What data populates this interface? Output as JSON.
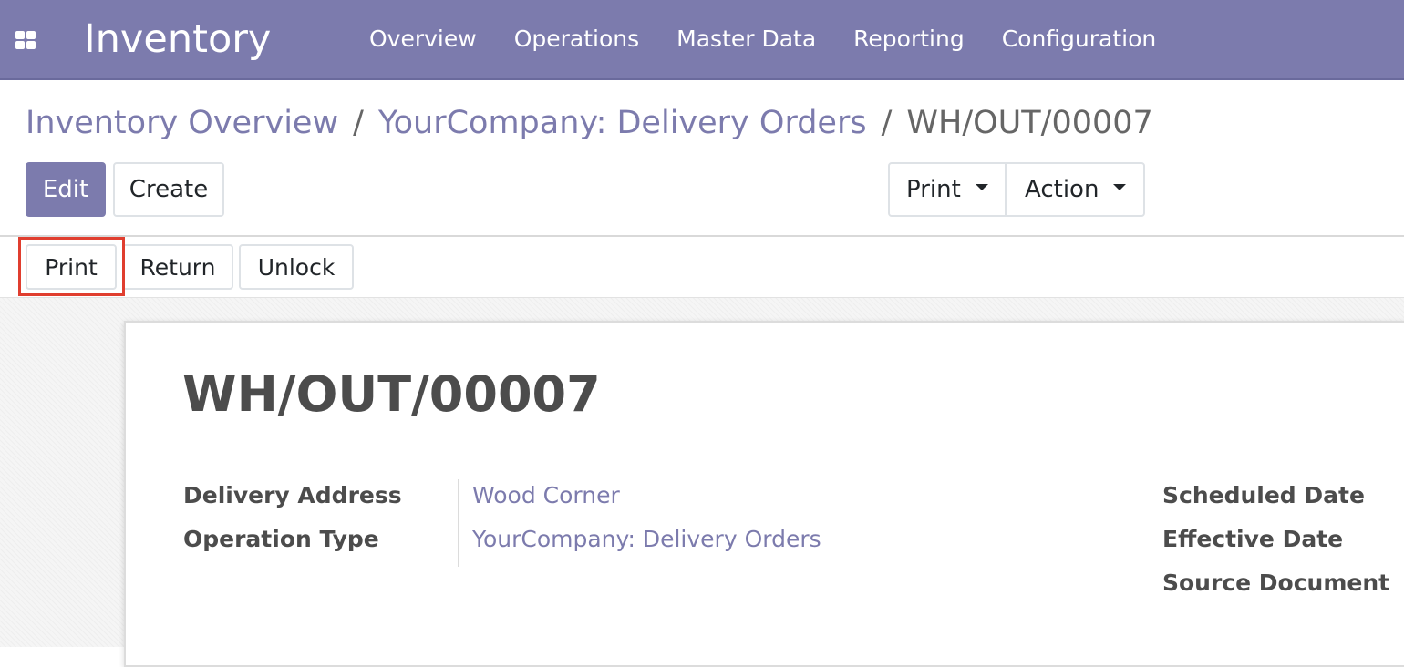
{
  "navbar": {
    "app_title": "Inventory",
    "menu": [
      "Overview",
      "Operations",
      "Master Data",
      "Reporting",
      "Configuration"
    ],
    "apps_icon": "apps-grid-icon"
  },
  "breadcrumb": {
    "items": [
      "Inventory Overview",
      "YourCompany: Delivery Orders"
    ],
    "separator": "/",
    "current": "WH/OUT/00007"
  },
  "control_panel": {
    "edit_label": "Edit",
    "create_label": "Create",
    "print_label": "Print",
    "action_label": "Action"
  },
  "statusbar": {
    "buttons": [
      "Print",
      "Return",
      "Unlock"
    ],
    "highlighted": "Print"
  },
  "form": {
    "name": "WH/OUT/00007",
    "left_fields": [
      {
        "label": "Delivery Address",
        "value": "Wood Corner"
      },
      {
        "label": "Operation Type",
        "value": "YourCompany: Delivery Orders"
      }
    ],
    "right_fields": [
      {
        "label": "Scheduled Date"
      },
      {
        "label": "Effective Date"
      },
      {
        "label": "Source Document"
      }
    ]
  },
  "colors": {
    "brand": "#7c7bad",
    "highlight": "#e03e2f"
  }
}
